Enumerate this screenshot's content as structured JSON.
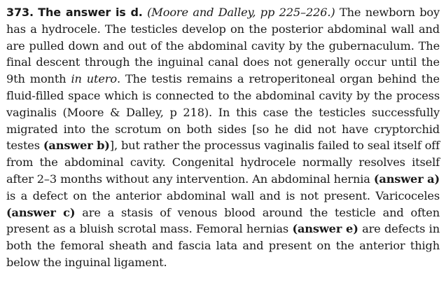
{
  "answer": {
    "number": "373.",
    "heading": "The answer is d.",
    "citation": "(Moore and Dalley, pp 225–226.)",
    "seg1": "The newborn boy has a hydrocele. The testicles develop on the posterior abdominal wall and are pulled down and out of the abdominal cavity by the gubernaculum. The final descent through the inguinal canal does not generally occur until the 9th month ",
    "in_utero": "in utero",
    "seg2": ". The testis remains a retroperitoneal organ behind the fluid-filled space which is connected to the abdominal cavity by the process vaginalis (Moore & Dalley, p 218). In this case the testicles successfully migrated into the scrotum on both sides [so he did not have cryptorchid testes ",
    "ref_b": "(answer b)",
    "seg3": "], but rather the processus vaginalis failed to seal itself off from the abdominal cavity. Congenital hydrocele normally resolves itself after 2–3 months without any intervention. An abdominal hernia ",
    "ref_a": "(answer a)",
    "seg4": " is a defect on the anterior abdominal wall and is not present. Varicoceles ",
    "ref_c": "(answer c)",
    "seg5": " are a stasis of venous blood around the testicle and often present as a bluish scrotal mass. Femoral hernias ",
    "ref_e": "(answer e)",
    "seg6": " are defects in both the femoral sheath and fascia lata and present on the anterior thigh below the inguinal ligament."
  }
}
